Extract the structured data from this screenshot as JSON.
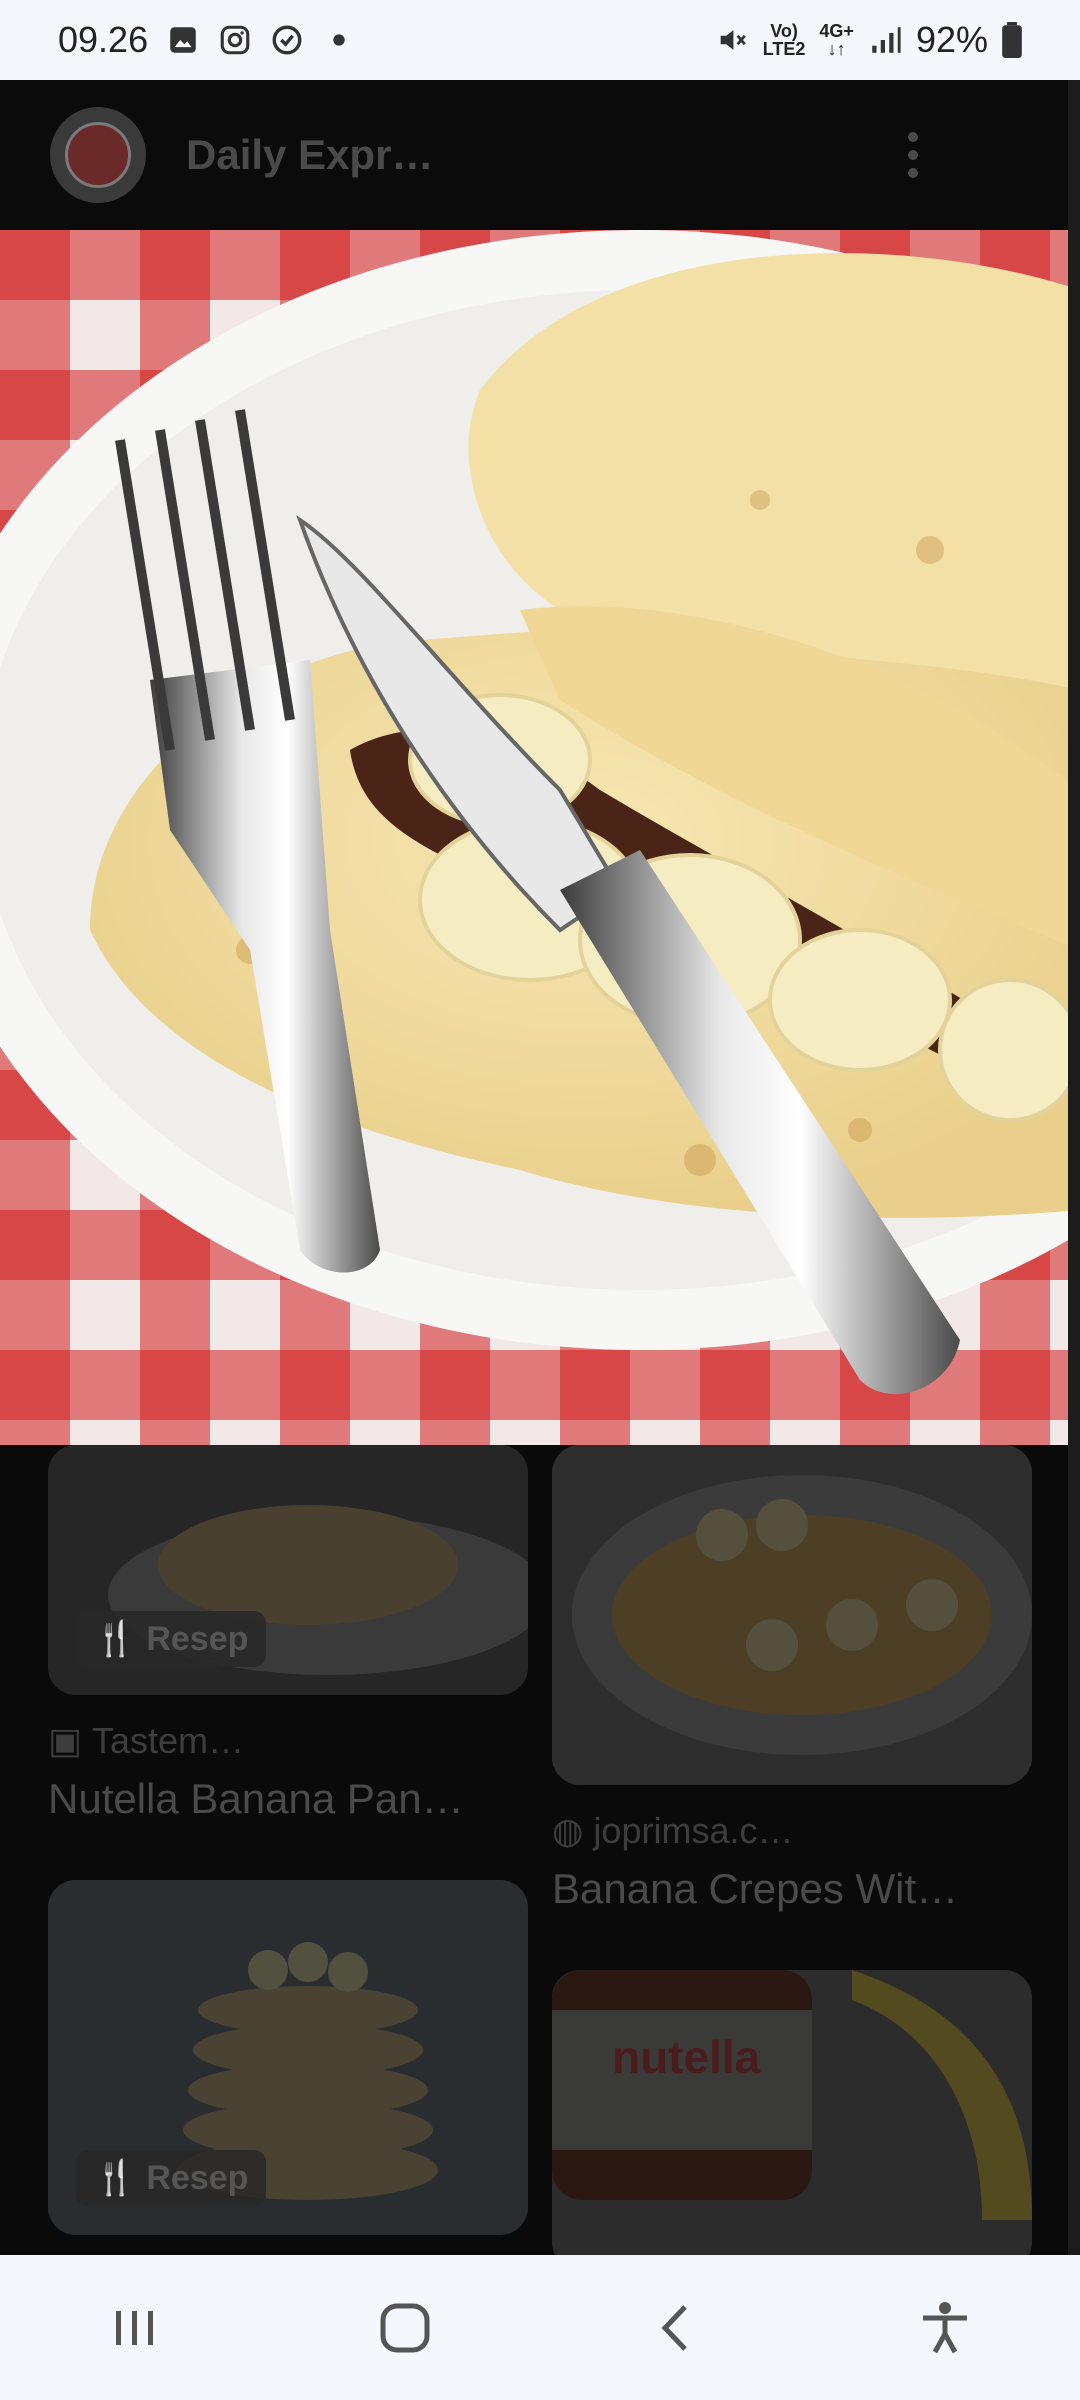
{
  "status_bar": {
    "time": "09.26",
    "network_top": "Vo)",
    "network_bottom": "LTE2",
    "data_type": "4G+",
    "battery": "92%",
    "icons": [
      "gallery-icon",
      "instagram-icon",
      "chat-icon",
      "dot-icon",
      "mute-icon",
      "signal-icon",
      "battery-icon"
    ]
  },
  "app_bar": {
    "title": "Daily Expr…",
    "menu_icon": "more-vert-icon"
  },
  "hero": {
    "description_icon": "image"
  },
  "cards": [
    {
      "badge": "Resep",
      "source": "Tastem…",
      "title": "Nutella Banana Pan…"
    },
    {
      "badge": "",
      "source": "joprimsa.c…",
      "title": "Banana Crepes Wit…"
    },
    {
      "badge": "Resep",
      "source": "",
      "title": ""
    },
    {
      "badge": "",
      "source": "",
      "title": "",
      "logo_text": "nutella"
    }
  ],
  "nav_bar": {
    "icons": [
      "recents-icon",
      "home-icon",
      "back-icon",
      "accessibility-icon"
    ]
  },
  "colors": {
    "status_bg": "#f4f7fb",
    "dim_overlay": "#000000"
  }
}
